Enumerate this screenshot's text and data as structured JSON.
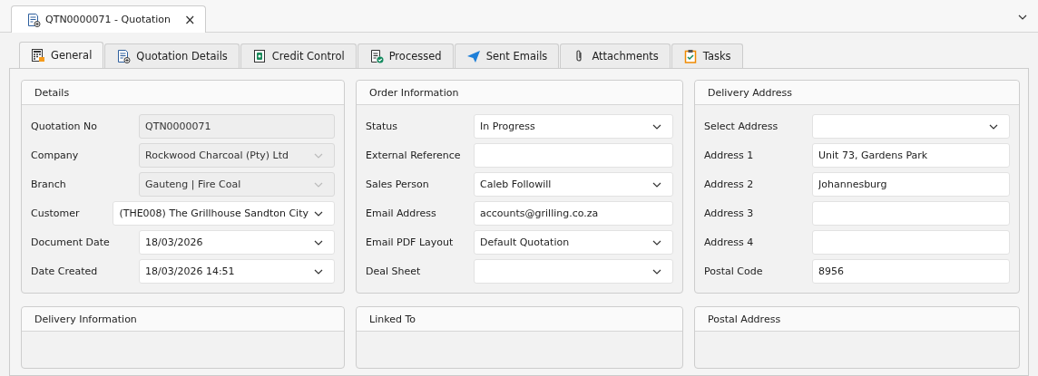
{
  "document_tab": {
    "title": "QTN0000071 - Quotation",
    "close": "×"
  },
  "tabs": [
    {
      "label": "General",
      "selected": true
    },
    {
      "label": "Quotation Details",
      "selected": false
    },
    {
      "label": "Credit Control",
      "selected": false
    },
    {
      "label": "Processed",
      "selected": false
    },
    {
      "label": "Sent Emails",
      "selected": false
    },
    {
      "label": "Attachments",
      "selected": false
    },
    {
      "label": "Tasks",
      "selected": false
    }
  ],
  "columns": [
    {
      "groups": [
        {
          "title": "Details",
          "fields": [
            {
              "label": "Quotation No",
              "value": "QTN0000071",
              "kind": "text",
              "disabled": true
            },
            {
              "label": "Company",
              "value": "Rockwood Charcoal (Pty) Ltd",
              "kind": "combo",
              "disabled": true
            },
            {
              "label": "Branch",
              "value": "Gauteng | Fire Coal",
              "kind": "combo",
              "disabled": true
            },
            {
              "label": "Customer",
              "value": "(THE008) The Grillhouse Sandton City",
              "kind": "combo",
              "disabled": false
            },
            {
              "label": "Document Date",
              "value": "18/03/2026",
              "kind": "combo",
              "disabled": false
            },
            {
              "label": "Date Created",
              "value": "18/03/2026 14:51",
              "kind": "combo",
              "disabled": false
            }
          ]
        },
        {
          "title": "Delivery Information"
        }
      ]
    },
    {
      "groups": [
        {
          "title": "Order Information",
          "fields": [
            {
              "label": "Status",
              "value": "In Progress",
              "kind": "combo",
              "disabled": false
            },
            {
              "label": "External Reference",
              "kind": "text",
              "disabled": false
            },
            {
              "label": "Sales Person",
              "value": "Caleb Followill",
              "kind": "combo",
              "disabled": false
            },
            {
              "label": "Email Address",
              "value": "accounts@grilling.co.za",
              "kind": "text",
              "disabled": false
            },
            {
              "label": "Email PDF Layout",
              "value": "Default Quotation",
              "kind": "combo",
              "disabled": false
            },
            {
              "label": "Deal Sheet",
              "kind": "combo",
              "disabled": false
            }
          ]
        },
        {
          "title": "Linked To"
        }
      ]
    },
    {
      "groups": [
        {
          "title": "Delivery Address",
          "fields": [
            {
              "label": "Select Address",
              "kind": "combo",
              "disabled": false
            },
            {
              "label": "Address 1",
              "value": "Unit 73, Gardens Park",
              "kind": "text",
              "disabled": false
            },
            {
              "label": "Address 2",
              "value": "Johannesburg",
              "kind": "text",
              "disabled": false
            },
            {
              "label": "Address 3",
              "kind": "text",
              "disabled": false
            },
            {
              "label": "Address 4",
              "kind": "text",
              "disabled": false
            },
            {
              "label": "Postal Code",
              "value": "8956",
              "kind": "text",
              "disabled": false
            }
          ]
        },
        {
          "title": "Postal Address"
        }
      ]
    }
  ]
}
